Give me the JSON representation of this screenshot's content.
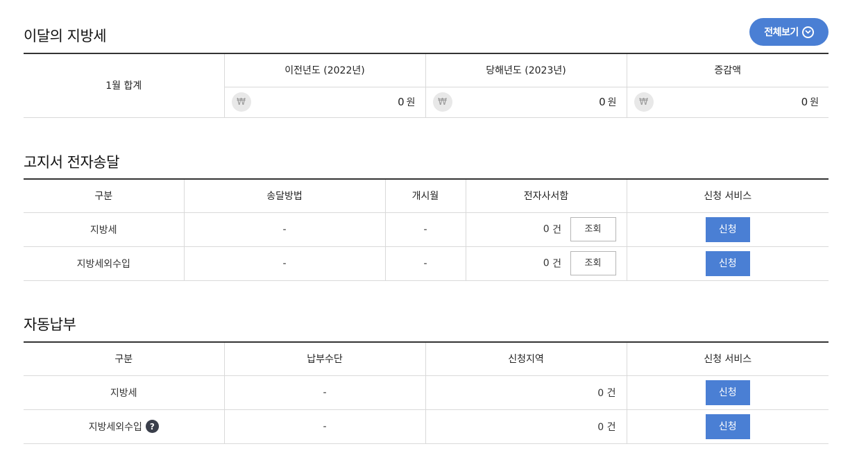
{
  "local_tax": {
    "title": "이달의 지방세",
    "view_all_label": "전체보기",
    "row_label": "1월 합계",
    "columns": [
      "이전년도 (2022년)",
      "당해년도 (2023년)",
      "증감액"
    ],
    "currency_symbol": "₩",
    "amounts": [
      "0",
      "0",
      "0"
    ],
    "unit": "원"
  },
  "notice": {
    "title": "고지서 전자송달",
    "columns": [
      "구분",
      "송달방법",
      "개시월",
      "전자사서함",
      "신청 서비스"
    ],
    "rows": [
      {
        "category": "지방세",
        "method": "-",
        "start": "-",
        "count": "0",
        "count_unit": "건",
        "query_label": "조회",
        "apply_label": "신청"
      },
      {
        "category": "지방세외수입",
        "method": "-",
        "start": "-",
        "count": "0",
        "count_unit": "건",
        "query_label": "조회",
        "apply_label": "신청"
      }
    ]
  },
  "autopay": {
    "title": "자동납부",
    "columns": [
      "구분",
      "납부수단",
      "신청지역",
      "신청 서비스"
    ],
    "rows": [
      {
        "category": "지방세",
        "means": "-",
        "count": "0",
        "count_unit": "건",
        "apply_label": "신청"
      },
      {
        "category": "지방세외수입",
        "means": "-",
        "count": "0",
        "count_unit": "건",
        "apply_label": "신청",
        "help_icon": "question-icon",
        "help_glyph": "?"
      }
    ]
  },
  "colors": {
    "accent": "#4a7fd4",
    "border_dark": "#333333",
    "border_light": "#d9d9d9",
    "won_bg": "#e8e8e8"
  }
}
